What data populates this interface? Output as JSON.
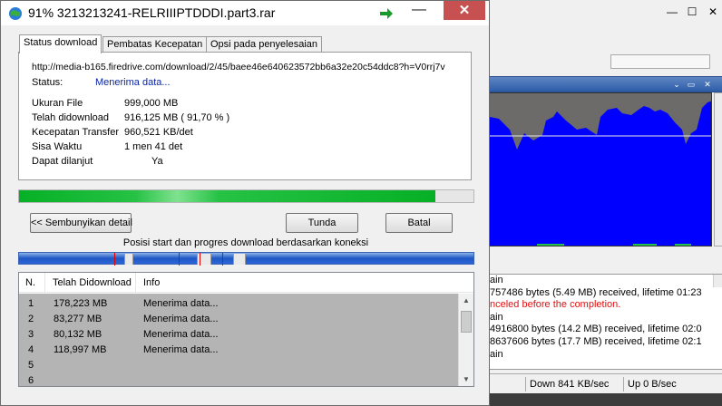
{
  "dialog": {
    "title": "91% 3213213241-RELRIIIPTDDDI.part3.rar",
    "minimize_symbol": "—",
    "close_symbol": "✕",
    "tabs": [
      {
        "label": "Status download",
        "active": true
      },
      {
        "label": "Pembatas Kecepatan",
        "active": false
      },
      {
        "label": "Opsi pada penyelesaian",
        "active": false
      }
    ],
    "url": "http://media-b165.firedrive.com/download/2/45/baee46e640623572bb6a32e20c54ddc8?h=V0rrj7v",
    "status_label": "Status:",
    "status_value": "Menerima data...",
    "fields": [
      {
        "label": "Ukuran File",
        "value": "999,000  MB"
      },
      {
        "label": "Telah didownload",
        "value": "916,125  MB  ( 91,70 % )"
      },
      {
        "label": "Kecepatan Transfer",
        "value": "960,521  KB/det"
      },
      {
        "label": "Sisa Waktu",
        "value": "1 men 41 det"
      },
      {
        "label": "Dapat dilanjut",
        "value": "Ya"
      }
    ],
    "progress_fraction": 0.917,
    "buttons": {
      "hide_details": "<< Sembunyikan detail",
      "pause": "Tunda",
      "cancel": "Batal"
    },
    "connections_caption": "Posisi start dan progres download berdasarkan koneksi",
    "connections_list": {
      "headers": [
        "N.",
        "Telah Didownload",
        "Info"
      ],
      "rows": [
        {
          "n": "1",
          "downloaded": "178,223 MB",
          "info": "Menerima data..."
        },
        {
          "n": "2",
          "downloaded": "83,277 MB",
          "info": "Menerima data..."
        },
        {
          "n": "3",
          "downloaded": "80,132 MB",
          "info": "Menerima data..."
        },
        {
          "n": "4",
          "downloaded": "118,997 MB",
          "info": "Menerima data..."
        },
        {
          "n": "5",
          "downloaded": "",
          "info": ""
        },
        {
          "n": "6",
          "downloaded": "",
          "info": ""
        }
      ]
    }
  },
  "background_window": {
    "min_symbol": "—",
    "max_symbol": "☐",
    "close_symbol": "✕",
    "graph_buttons": [
      "⌄",
      "▭",
      "✕"
    ],
    "log_lines": [
      {
        "text": "ain",
        "error": false
      },
      {
        "text": "757486 bytes (5.49 MB) received, lifetime 01:23",
        "error": false
      },
      {
        "text": "nceled before the completion.",
        "error": true
      },
      {
        "text": "ain",
        "error": false
      },
      {
        "text": "4916800 bytes (14.2 MB) received, lifetime 02:0",
        "error": false
      },
      {
        "text": "8637606 bytes (17.7 MB) received, lifetime 02:1",
        "error": false
      },
      {
        "text": "ain",
        "error": false
      }
    ],
    "statusbar": {
      "down": "Down 841 KB/sec",
      "up": "Up 0 B/sec"
    }
  },
  "colors": {
    "progress_green": "#06b025",
    "graph_fill": "#0000ff",
    "graph_bg": "#6d6a6a",
    "close_red": "#c75050",
    "status_blue": "#0a24a8"
  }
}
